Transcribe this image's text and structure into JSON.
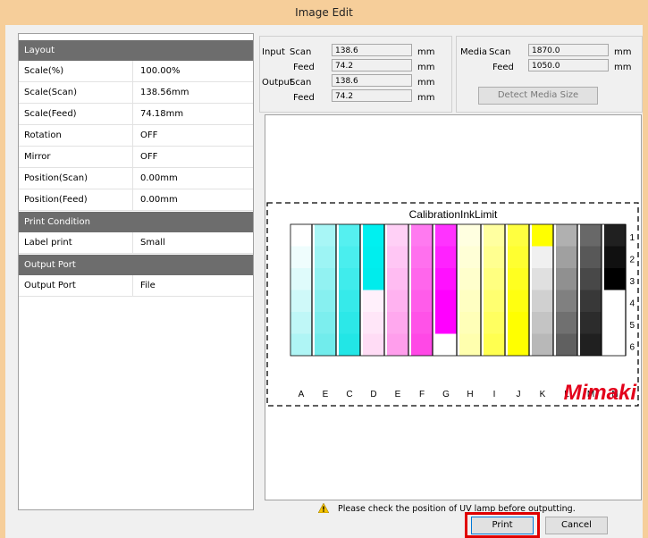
{
  "window": {
    "title": "Image Edit"
  },
  "properties": {
    "layout_header": "Layout",
    "layout_rows": [
      {
        "label": "Scale(%)",
        "value": "100.00%"
      },
      {
        "label": "Scale(Scan)",
        "value": "138.56mm"
      },
      {
        "label": "Scale(Feed)",
        "value": "74.18mm"
      },
      {
        "label": "Rotation",
        "value": "OFF"
      },
      {
        "label": "Mirror",
        "value": "OFF"
      },
      {
        "label": "Position(Scan)",
        "value": "0.00mm"
      },
      {
        "label": "Position(Feed)",
        "value": "0.00mm"
      }
    ],
    "print_header": "Print Condition",
    "print_rows": [
      {
        "label": "Label print",
        "value": "Small"
      }
    ],
    "output_header": "Output Port",
    "output_rows": [
      {
        "label": "Output Port",
        "value": "File"
      }
    ]
  },
  "size_group": {
    "input_label": "Input",
    "output_label": "Output",
    "scan_label": "Scan",
    "feed_label": "Feed",
    "input_scan": "138.6",
    "input_feed": "74.2",
    "output_scan": "138.6",
    "output_feed": "74.2",
    "unit": "mm"
  },
  "media_group": {
    "media_label": "Media",
    "scan_label": "Scan",
    "feed_label": "Feed",
    "scan": "1870.0",
    "feed": "1050.0",
    "unit": "mm",
    "detect_button": "Detect Media Size"
  },
  "preview": {
    "chart_title": "CalibrationInkLimit",
    "columns": [
      "A",
      "E",
      "C",
      "D",
      "E",
      "F",
      "G",
      "H",
      "I",
      "J",
      "K",
      "L",
      "M",
      "N"
    ],
    "rows": [
      "1",
      "2",
      "3",
      "4",
      "5",
      "6"
    ],
    "brand": "Mimaki"
  },
  "footer": {
    "warning": "Please check the position of UV lamp before outputting.",
    "print_button": "Print",
    "cancel_button": "Cancel"
  },
  "colors": {
    "accent_highlight": "#e00000",
    "title_bar": "#f6ce9a",
    "section_header": "#6d6d6d",
    "brand_red": "#e3001b"
  }
}
